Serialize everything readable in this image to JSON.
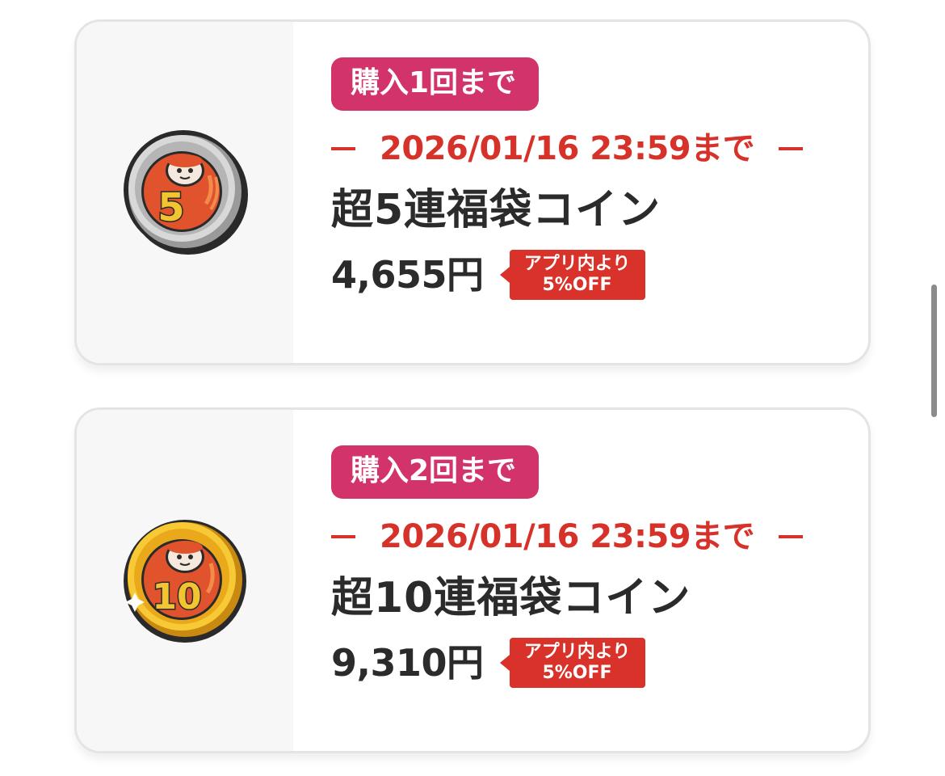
{
  "products": [
    {
      "limit_label": "購入1回まで",
      "deadline": "2026/01/16 23:59まで",
      "name": "超5連福袋コイン",
      "price": "4,655円",
      "discount_line1": "アプリ内より",
      "discount_line2": "5%OFF",
      "coin_number": "5",
      "coin_icon": "daruma-silver-coin-icon"
    },
    {
      "limit_label": "購入2回まで",
      "deadline": "2026/01/16 23:59まで",
      "name": "超10連福袋コイン",
      "price": "9,310円",
      "discount_line1": "アプリ内より",
      "discount_line2": "5%OFF",
      "coin_number": "10",
      "coin_icon": "daruma-gold-coin-icon"
    }
  ],
  "colors": {
    "limit_badge": "#d2336b",
    "deadline": "#d7322a",
    "discount": "#d9322b",
    "text": "#2b2b2b"
  }
}
